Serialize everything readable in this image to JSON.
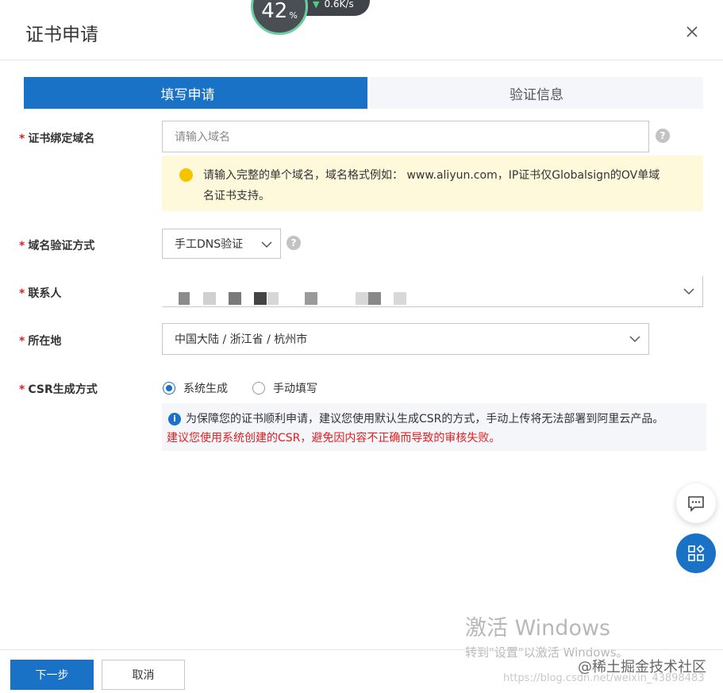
{
  "dialog": {
    "title": "证书申请"
  },
  "speed_widget": {
    "percent": "42",
    "percent_unit": "%",
    "speed": "0.6K/s"
  },
  "steps": [
    {
      "label": "填写申请",
      "active": true
    },
    {
      "label": "验证信息",
      "active": false
    }
  ],
  "form": {
    "domain": {
      "label": "证书绑定域名",
      "placeholder": "请输入域名",
      "notice_line1": "请输入完整的单个域名，域名格式例如： www.aliyun.com，IP证书仅Globalsign的OV单域",
      "notice_line2": "名证书支持。"
    },
    "verify_method": {
      "label": "域名验证方式",
      "value": "手工DNS验证"
    },
    "contact": {
      "label": "联系人"
    },
    "location": {
      "label": "所在地",
      "value": "中国大陆 / 浙江省 / 杭州市"
    },
    "csr": {
      "label": "CSR生成方式",
      "options": [
        {
          "label": "系统生成",
          "checked": true
        },
        {
          "label": "手动填写",
          "checked": false
        }
      ],
      "info_line1": "为保障您的证书顺利申请，建议您使用默认生成CSR的方式，手动上传将无法部署到阿里云产品。",
      "info_line2": "建议您使用系统创建的CSR，避免因内容不正确而导致的审核失败。"
    }
  },
  "footer": {
    "next_label": "下一步",
    "cancel_label": "取消"
  },
  "watermark": {
    "windows_line1": "激活 Windows",
    "windows_line2": "转到\"设置\"以激活 Windows。",
    "site": "@稀土掘金技术社区",
    "url": "https://blog.csdn.net/weixin_43898483"
  },
  "colors": {
    "primary": "#1a72c7",
    "required": "#e02020",
    "warning_bg": "#fff9dc",
    "info_bg": "#f4f6fa"
  }
}
